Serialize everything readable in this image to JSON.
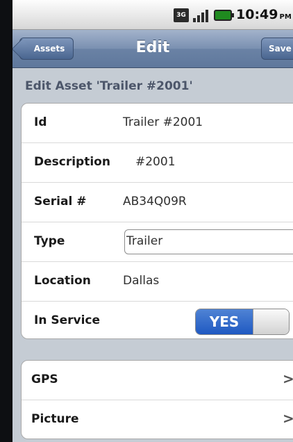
{
  "status_bar": {
    "network_label": "3G",
    "time": "10:49",
    "time_suffix": "PM"
  },
  "nav": {
    "back_label": "Assets",
    "title": "Edit",
    "save_label": "Save"
  },
  "section_title": "Edit Asset 'Trailer #2001'",
  "fields": [
    {
      "label": "Id",
      "value": "Trailer #2001"
    },
    {
      "label": "Description",
      "value": "#2001"
    },
    {
      "label": "Serial #",
      "value": "AB34Q09R"
    },
    {
      "label": "Type",
      "value": "Trailer"
    },
    {
      "label": "Location",
      "value": "Dallas"
    },
    {
      "label": "In Service",
      "value": "YES"
    }
  ],
  "links": [
    {
      "label": "GPS",
      "chevron": ">"
    },
    {
      "label": "Picture",
      "chevron": ">"
    }
  ],
  "colors": {
    "navbar": "#6a82a5",
    "toggle_on": "#1f59c2",
    "background": "#c5ccd4"
  },
  "icons": [
    "3g-icon",
    "signal-icon",
    "battery-icon",
    "chevron-right-icon"
  ]
}
